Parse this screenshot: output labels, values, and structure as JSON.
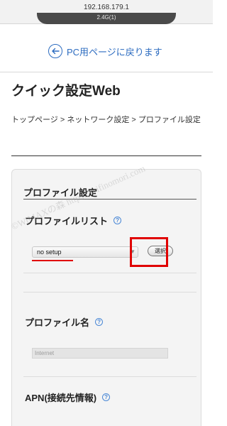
{
  "browser": {
    "url": "192.168.179.1",
    "tab_label": "2.4G(1)"
  },
  "back_link": {
    "label": "PC用ページに戻ります",
    "icon": "arrow-left-circle-icon"
  },
  "page": {
    "title": "クイック設定Web"
  },
  "breadcrumb": {
    "items": [
      "トップページ",
      "ネットワーク設定",
      "プロファイル設定"
    ],
    "separator": ">"
  },
  "panel": {
    "title": "プロファイル設定",
    "profile_list": {
      "label": "プロファイルリスト",
      "selected": "no setup",
      "button_label": "選択"
    },
    "profile_name": {
      "label": "プロファイル名",
      "value": "Internet"
    },
    "apn": {
      "label": "APN(接続先情報)"
    }
  },
  "watermark": "©WiMAXの森  https://wifinomori.com",
  "colors": {
    "link": "#2d6cc0",
    "highlight": "#e00000",
    "help_icon": "#4a88d6"
  }
}
